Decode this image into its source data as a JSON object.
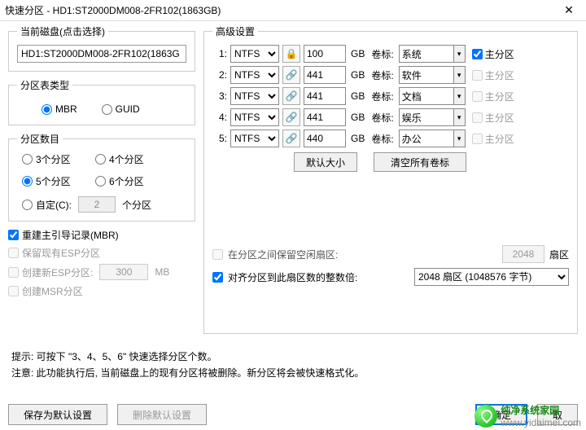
{
  "title": "快速分区 - HD1:ST2000DM008-2FR102(1863GB)",
  "left": {
    "curDiskLegend": "当前磁盘(点击选择)",
    "curDisk": "HD1:ST2000DM008-2FR102(1863G",
    "ptTypeLegend": "分区表类型",
    "mbr": "MBR",
    "guid": "GUID",
    "countLegend": "分区数目",
    "c3": "3个分区",
    "c4": "4个分区",
    "c5": "5个分区",
    "c6": "6个分区",
    "custom": "自定(C):",
    "customVal": "2",
    "customUnit": "个分区",
    "rebuild": "重建主引导记录(MBR)",
    "keepEsp": "保留现有ESP分区",
    "newEsp": "创建新ESP分区:",
    "espSize": "300",
    "mb": "MB",
    "msr": "创建MSR分区"
  },
  "adv": {
    "legend": "高级设置",
    "gb": "GB",
    "volLabel": "卷标:",
    "primary": "主分区",
    "rows": [
      {
        "i": "1:",
        "fs": "NTFS",
        "size": "100",
        "vol": "系统",
        "chk": true,
        "dis": false,
        "lock": true
      },
      {
        "i": "2:",
        "fs": "NTFS",
        "size": "441",
        "vol": "软件",
        "chk": false,
        "dis": true,
        "lock": false
      },
      {
        "i": "3:",
        "fs": "NTFS",
        "size": "441",
        "vol": "文档",
        "chk": false,
        "dis": true,
        "lock": false
      },
      {
        "i": "4:",
        "fs": "NTFS",
        "size": "441",
        "vol": "娱乐",
        "chk": false,
        "dis": true,
        "lock": false
      },
      {
        "i": "5:",
        "fs": "NTFS",
        "size": "440",
        "vol": "办公",
        "chk": false,
        "dis": true,
        "lock": false
      }
    ],
    "defSize": "默认大小",
    "clearVol": "清空所有卷标",
    "keepFree": "在分区之间保留空闲扇区:",
    "sectors": "2048",
    "sectUnit": "扇区",
    "align": "对齐分区到此扇区数的整数倍:",
    "alignVal": "2048 扇区 (1048576 字节)"
  },
  "tips": {
    "l1": "提示: 可按下 \"3、4、5、6\" 快速选择分区个数。",
    "l2": "注意: 此功能执行后, 当前磁盘上的现有分区将被删除。新分区将会被快速格式化。"
  },
  "bottom": {
    "saveDef": "保存为默认设置",
    "delDef": "删除默认设置",
    "ok": "确定",
    "cancel": "取"
  },
  "wm": {
    "name": "纯净系统家园",
    "url": "www.yidaimei.com"
  }
}
